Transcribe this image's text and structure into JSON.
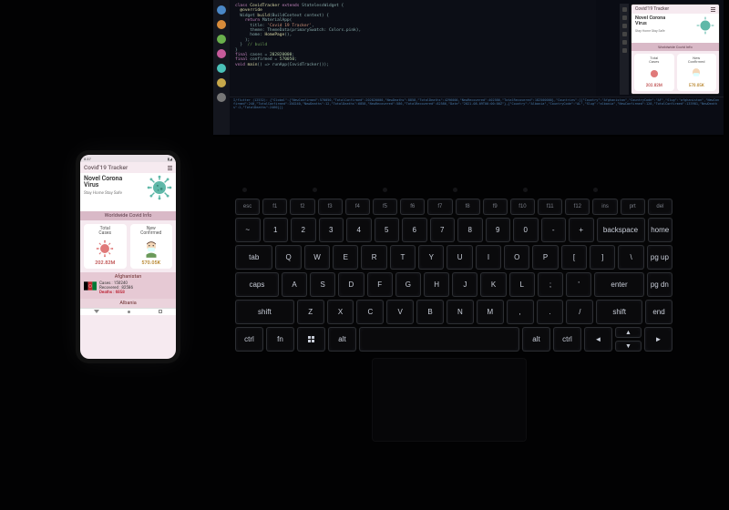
{
  "phone": {
    "status_time": "8:37",
    "app_title": "Covid'19 Tracker",
    "hero_title_l1": "Novel Corona",
    "hero_title_l2": "Virus",
    "hero_sub": "Stay Home Stay Safe",
    "section_banner": "Worldwide Covid Info",
    "cards": {
      "total": {
        "label_l1": "Total",
        "label_l2": "Cases",
        "value": "202.82M",
        "color": "#d66"
      },
      "new": {
        "label_l1": "New",
        "label_l2": "Confirmed",
        "value": "570.05K",
        "color": "#d9a441"
      }
    },
    "country1": {
      "name": "Afghanistan",
      "cases_label": "Cases :",
      "cases_value": "150240",
      "recovered_label": "Recovered :",
      "recovered_value": "82586",
      "deaths_label": "Deaths :",
      "deaths_value": "6858"
    },
    "country2": {
      "name": "Albania"
    }
  },
  "ide": {
    "activity_colors": [
      "#4a88c7",
      "#d98c3a",
      "#6ab04c",
      "#c75a9b",
      "#4ac1b8",
      "#c7a84a",
      "#777"
    ]
  },
  "keyboard": {
    "fn": [
      "esc",
      "f1",
      "f2",
      "f3",
      "f4",
      "f5",
      "f6",
      "f7",
      "f8",
      "f9",
      "f10",
      "f11",
      "f12",
      "ins",
      "prt",
      "del"
    ],
    "row1": [
      "~",
      "1",
      "2",
      "3",
      "4",
      "5",
      "6",
      "7",
      "8",
      "9",
      "0",
      "-",
      "+",
      "backspace",
      "home"
    ],
    "row2": [
      "tab",
      "Q",
      "W",
      "E",
      "R",
      "T",
      "Y",
      "U",
      "I",
      "O",
      "P",
      "[",
      "]",
      "\\",
      "pg up"
    ],
    "row3": [
      "caps",
      "A",
      "S",
      "D",
      "F",
      "G",
      "H",
      "J",
      "K",
      "L",
      ";",
      "'",
      "enter",
      "pg dn"
    ],
    "row4": [
      "shift",
      "Z",
      "X",
      "C",
      "V",
      "B",
      "N",
      "M",
      ",",
      ".",
      "/",
      "shift",
      "end"
    ],
    "row5": [
      "ctrl",
      "fn",
      "",
      "alt",
      "",
      "alt",
      "ctrl"
    ],
    "arrows": [
      "◄",
      "▲",
      "▼",
      "►"
    ]
  }
}
